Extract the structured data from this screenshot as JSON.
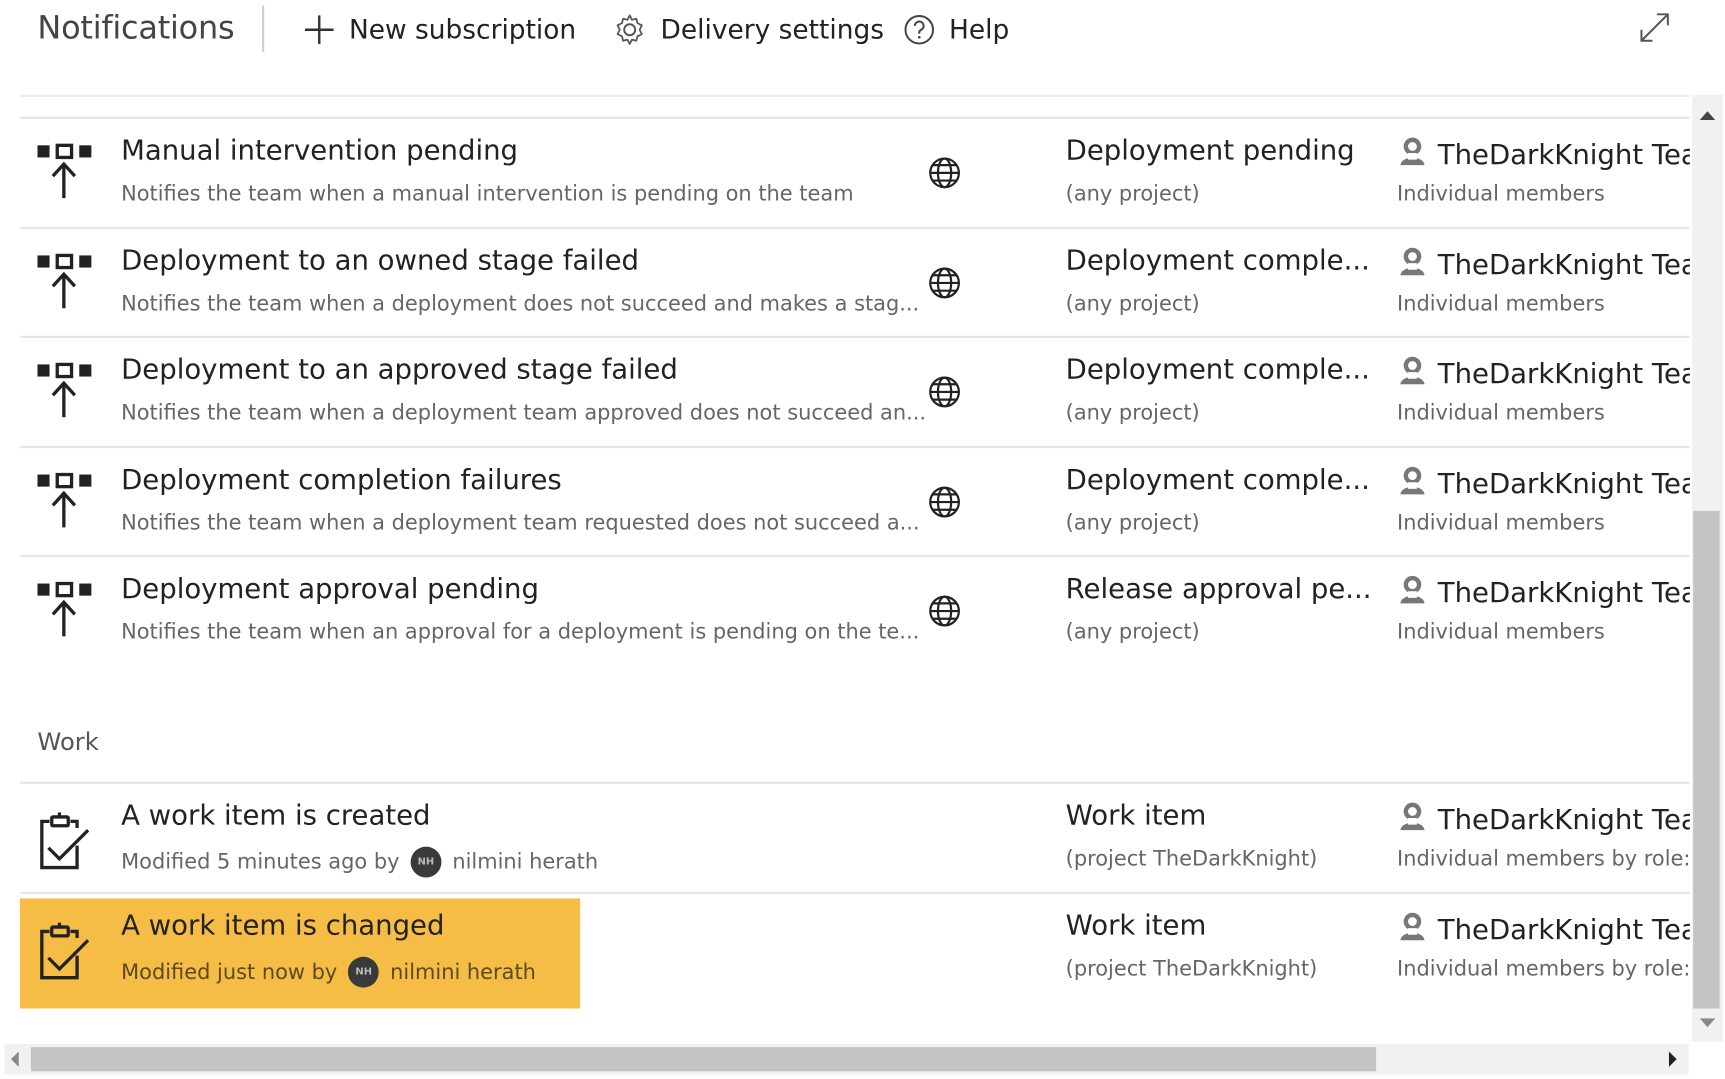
{
  "toolbar": {
    "title": "Notifications",
    "new_subscription": "New subscription",
    "delivery_settings": "Delivery settings",
    "help": "Help"
  },
  "rows": [
    {
      "title": "Manual intervention pending",
      "description": "Notifies the team when a manual intervention is pending on the team",
      "event": "Deployment pending",
      "event_scope": "(any project)",
      "subscriber": "TheDarkKnight Tea",
      "delivery": "Individual members",
      "icon": "release-pipeline-icon"
    },
    {
      "title": "Deployment to an owned stage failed",
      "description": "Notifies the team when a deployment does not succeed and makes a stag...",
      "event": "Deployment comple...",
      "event_scope": "(any project)",
      "subscriber": "TheDarkKnight Tea",
      "delivery": "Individual members",
      "icon": "release-pipeline-icon"
    },
    {
      "title": "Deployment to an approved stage failed",
      "description": "Notifies the team when a deployment team approved does not succeed an...",
      "event": "Deployment comple...",
      "event_scope": "(any project)",
      "subscriber": "TheDarkKnight Tea",
      "delivery": "Individual members",
      "icon": "release-pipeline-icon"
    },
    {
      "title": "Deployment completion failures",
      "description": "Notifies the team when a deployment team requested does not succeed a...",
      "event": "Deployment comple...",
      "event_scope": "(any project)",
      "subscriber": "TheDarkKnight Tea",
      "delivery": "Individual members",
      "icon": "release-pipeline-icon"
    },
    {
      "title": "Deployment approval pending",
      "description": "Notifies the team when an approval for a deployment is pending on the te...",
      "event": "Release approval pe...",
      "event_scope": "(any project)",
      "subscriber": "TheDarkKnight Tea",
      "delivery": "Individual members",
      "icon": "release-pipeline-icon"
    }
  ],
  "work_section": {
    "label": "Work",
    "rows": [
      {
        "title": "A work item is created",
        "modified_prefix": "Modified 5 minutes ago by",
        "avatar_initials": "NH",
        "author": "nilmini herath",
        "event": "Work item",
        "event_scope": "(project TheDarkKnight)",
        "subscriber": "TheDarkKnight Tea",
        "delivery": "Individual members by role:",
        "selected": false,
        "icon": "work-item-clipboard-icon"
      },
      {
        "title": "A work item is changed",
        "modified_prefix": "Modified just now by",
        "avatar_initials": "NH",
        "author": "nilmini herath",
        "event": "Work item",
        "event_scope": "(project TheDarkKnight)",
        "subscriber": "TheDarkKnight Tea",
        "delivery": "Individual members by role:",
        "selected": true,
        "icon": "work-item-clipboard-icon"
      }
    ]
  },
  "colors": {
    "selection": "#f5bd46",
    "text": "#222222",
    "muted": "#666666"
  }
}
